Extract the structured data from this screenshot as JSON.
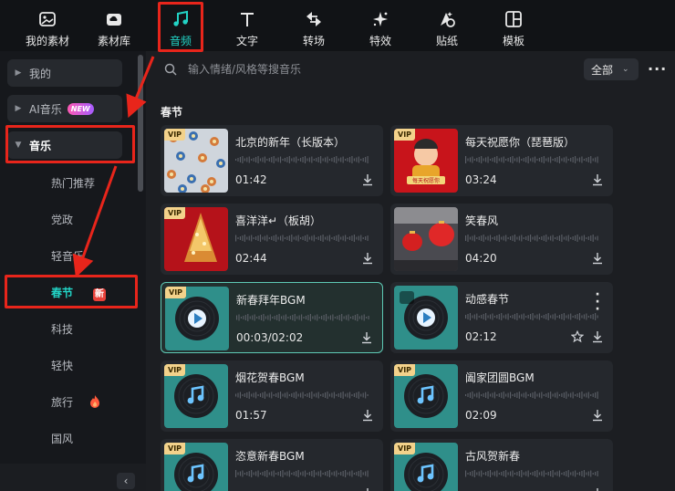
{
  "toolbar": {
    "tabs": [
      {
        "label": "我的素材",
        "icon": "image-icon"
      },
      {
        "label": "素材库",
        "icon": "cloud-folder-icon"
      },
      {
        "label": "音频",
        "icon": "music-note-icon",
        "active": true
      },
      {
        "label": "文字",
        "icon": "text-t-icon"
      },
      {
        "label": "转场",
        "icon": "transition-icon"
      },
      {
        "label": "特效",
        "icon": "sparkle-icon"
      },
      {
        "label": "贴纸",
        "icon": "sticker-icon"
      },
      {
        "label": "模板",
        "icon": "template-grid-icon"
      }
    ]
  },
  "sidebar": {
    "groups": [
      {
        "label": "我的"
      },
      {
        "label": "AI音乐",
        "badge": "NEW"
      },
      {
        "label": "音乐",
        "open": true
      }
    ],
    "items": [
      {
        "label": "热门推荐"
      },
      {
        "label": "党政"
      },
      {
        "label": "轻音乐"
      },
      {
        "label": "春节",
        "active": true,
        "badge": "新"
      },
      {
        "label": "科技"
      },
      {
        "label": "轻快"
      },
      {
        "label": "旅行",
        "hot": true
      },
      {
        "label": "国风"
      }
    ],
    "collapse_icon": "‹"
  },
  "search": {
    "placeholder": "输入情绪/风格等搜音乐",
    "filter_label": "全部",
    "more_label": "···"
  },
  "section": {
    "title": "春节"
  },
  "tracks": [
    {
      "title": "北京的新年（长版本）",
      "duration": "01:42",
      "vip": "VIP",
      "thumb": "floral"
    },
    {
      "title": "每天祝愿你（琵琶版）",
      "duration": "03:24",
      "vip": "VIP",
      "thumb": "newyear-kid"
    },
    {
      "title": "喜洋洋↵（板胡）",
      "duration": "02:44",
      "vip": "VIP",
      "thumb": "red-tree"
    },
    {
      "title": "笑春风",
      "duration": "04:20",
      "vip": "",
      "thumb": "lanterns"
    },
    {
      "title": "新春拜年BGM",
      "duration": "00:03/02:02",
      "vip": "VIP",
      "thumb": "disc-play",
      "selected": true
    },
    {
      "title": "动感春节",
      "duration": "02:12",
      "vip": "",
      "thumb": "disc-play",
      "hover": true
    },
    {
      "title": "烟花贺春BGM",
      "duration": "01:57",
      "vip": "VIP",
      "thumb": "disc-note"
    },
    {
      "title": "阖家团圆BGM",
      "duration": "02:09",
      "vip": "VIP",
      "thumb": "disc-note"
    },
    {
      "title": "恣意新春BGM",
      "duration": "",
      "vip": "VIP",
      "thumb": "disc-note"
    },
    {
      "title": "古风贺新春",
      "duration": "",
      "vip": "VIP",
      "thumb": "disc-note"
    }
  ],
  "colors": {
    "accent": "#22d3c5",
    "annotation": "#e8251b",
    "vip": "#f3d28b"
  }
}
